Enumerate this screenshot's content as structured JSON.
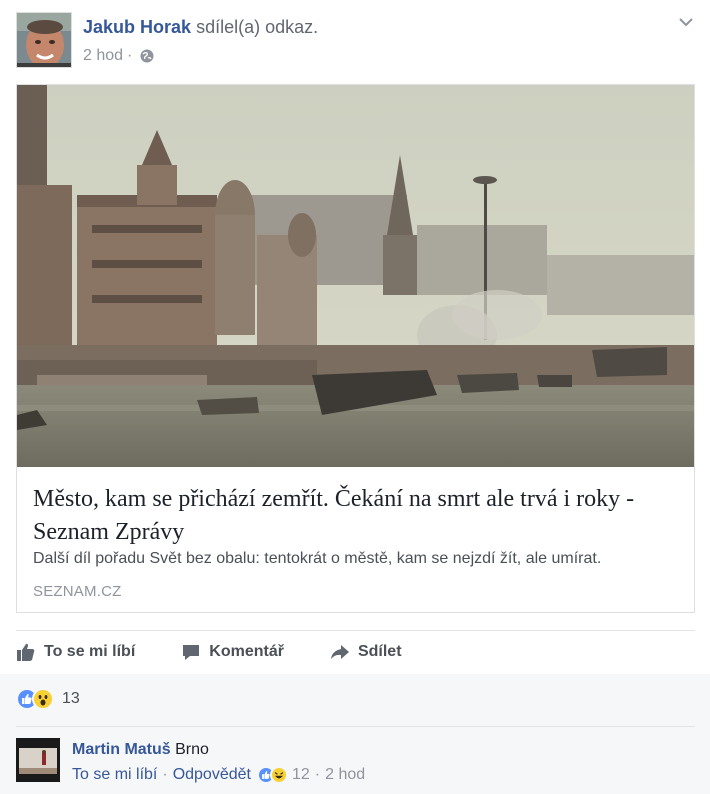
{
  "post": {
    "author_name": "Jakub Horak",
    "author_action": "sdílel(a) odkaz.",
    "time": "2 hod",
    "separator": "·",
    "privacy_icon": "globe-icon"
  },
  "link": {
    "title": "Město, kam se přichází zemřít. Čekání na smrt ale trvá i roky - Seznam Zprávy",
    "description": "Další díl pořadu Svět bez obalu: tentokrát o městě, kam se nejzdí žít, ale umírat.",
    "domain": "SEZNAM.CZ"
  },
  "actions": {
    "like": "To se mi líbí",
    "comment": "Komentář",
    "share": "Sdílet"
  },
  "reactions": {
    "count": "13",
    "types": [
      "like",
      "wow"
    ]
  },
  "comment": {
    "author": "Martin Matuš",
    "text": "Brno",
    "like": "To se mi líbí",
    "reply": "Odpovědět",
    "dot": "·",
    "reaction_count": "12",
    "time": "2 hod",
    "reaction_types": [
      "like",
      "haha"
    ]
  },
  "colors": {
    "link_blue": "#365899",
    "like_blue": "#5890ff",
    "reaction_yellow": "#f7d035"
  }
}
